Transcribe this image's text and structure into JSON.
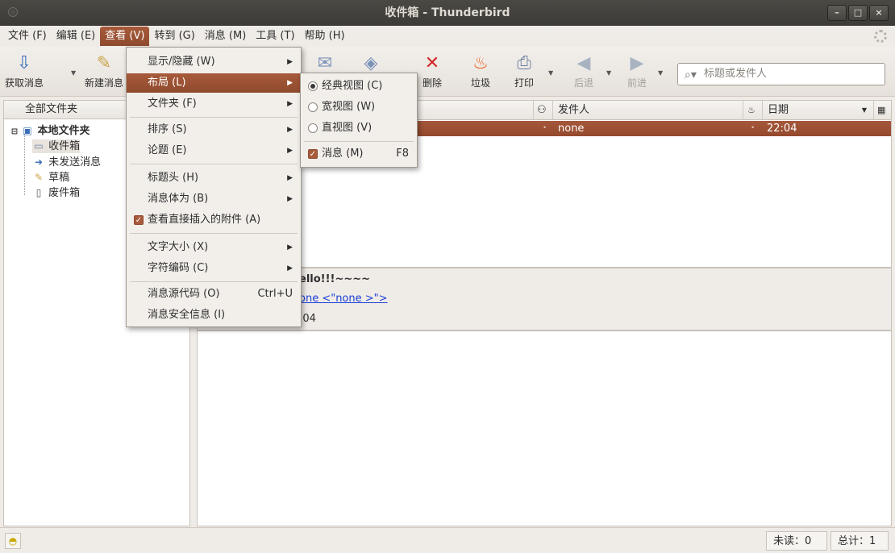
{
  "window": {
    "title": "收件箱 - Thunderbird"
  },
  "window_buttons": [
    "–",
    "□",
    "×"
  ],
  "menubar": [
    {
      "label": "文件 (F)",
      "name": "menu-file"
    },
    {
      "label": "编辑 (E)",
      "name": "menu-edit"
    },
    {
      "label": "查看 (V)",
      "name": "menu-view"
    },
    {
      "label": "转到 (G)",
      "name": "menu-go"
    },
    {
      "label": "消息 (M)",
      "name": "menu-message"
    },
    {
      "label": "工具 (T)",
      "name": "menu-tools"
    },
    {
      "label": "帮助 (H)",
      "name": "menu-help"
    }
  ],
  "toolbar": {
    "get_mail": "获取消息",
    "new_msg": "新建消息",
    "delete": "删除",
    "junk": "垃圾",
    "print": "打印",
    "back": "后退",
    "forward": "前进"
  },
  "search": {
    "placeholder": "标题或发件人"
  },
  "folders": {
    "header": "全部文件夹",
    "root": "本地文件夹",
    "items": [
      "收件箱",
      "未发送消息",
      "草稿",
      "废件箱"
    ]
  },
  "threads": {
    "columns": {
      "sender": "发件人",
      "date": "日期"
    },
    "rows": [
      {
        "sender": "none",
        "date": "22:04"
      }
    ]
  },
  "message": {
    "subject_fragment": "ello!!!~~~~",
    "from_fragment": "one <\"none >\">",
    "date_fragment": ":04"
  },
  "status": {
    "unread": "未读：0",
    "total": "总计：1"
  },
  "view_menu": {
    "items": [
      "显示/隐藏 (W)",
      "布局 (L)",
      "文件夹 (F)",
      "排序 (S)",
      "论题 (E)",
      "标题头 (H)",
      "消息体为 (B)",
      "查看直接插入的附件 (A)",
      "文字大小 (X)",
      "字符编码 (C)",
      "消息源代码 (O)",
      "消息安全信息 (I)"
    ],
    "shortcut_source": "Ctrl+U"
  },
  "layout_submenu": {
    "items": [
      "经典视图 (C)",
      "宽视图 (W)",
      "直视图 (V)",
      "消息 (M)"
    ],
    "shortcut_message": "F8",
    "selected": "经典视图 (C)"
  }
}
